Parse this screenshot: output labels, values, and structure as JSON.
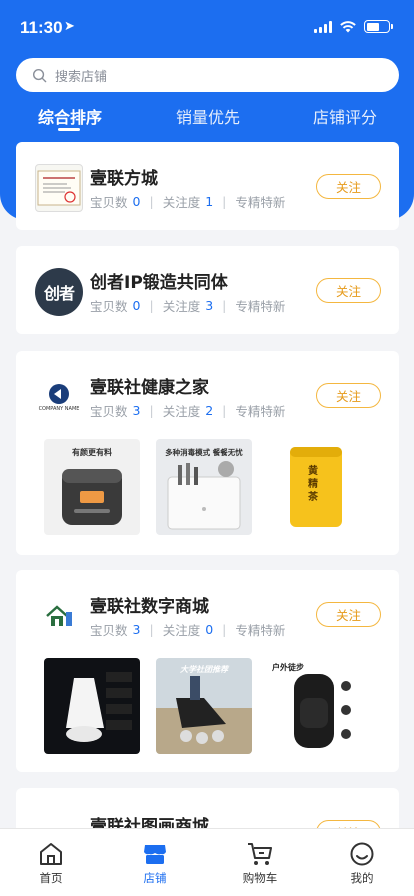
{
  "status_bar": {
    "time": "11:30",
    "location_arrow": "➤"
  },
  "search": {
    "placeholder": "搜索店铺",
    "icon": "search-icon"
  },
  "tabs": [
    {
      "label": "综合排序",
      "active": true
    },
    {
      "label": "销量优先",
      "active": false
    },
    {
      "label": "店铺评分",
      "active": false
    }
  ],
  "stores": [
    {
      "name": "壹联方城",
      "items_label": "宝贝数",
      "items": "0",
      "follow_label": "关注度",
      "follow_count": "1",
      "tag": "专精特新",
      "button": "关注"
    },
    {
      "name": "创者IP锻造共同体",
      "items_label": "宝贝数",
      "items": "0",
      "follow_label": "关注度",
      "follow_count": "3",
      "tag": "专精特新",
      "button": "关注",
      "logo_text": "创者"
    },
    {
      "name": "壹联社健康之家",
      "items_label": "宝贝数",
      "items": "3",
      "follow_label": "关注度",
      "follow_count": "2",
      "tag": "专精特新",
      "button": "关注",
      "logo_caption": "COMPANY NAME",
      "products": [
        {
          "caption": "有颜更有料"
        },
        {
          "caption": "多种消毒模式 餐餐无忧"
        },
        {
          "caption": "黄精茶"
        }
      ]
    },
    {
      "name": "壹联社数字商城",
      "items_label": "宝贝数",
      "items": "3",
      "follow_label": "关注度",
      "follow_count": "0",
      "tag": "专精特新",
      "button": "关注",
      "products": [
        {
          "caption": ""
        },
        {
          "caption": "大学社团推荐"
        },
        {
          "caption": "户外徒步"
        }
      ]
    },
    {
      "name": "壹联社图画商城",
      "button": "关注"
    }
  ],
  "tabbar": [
    {
      "label": "首页",
      "icon": "home-icon",
      "active": false
    },
    {
      "label": "店铺",
      "icon": "store-icon",
      "active": true
    },
    {
      "label": "购物车",
      "icon": "cart-icon",
      "active": false
    },
    {
      "label": "我的",
      "icon": "profile-icon",
      "active": false
    }
  ],
  "colors": {
    "primary": "#1c6ef0",
    "follow_border": "#f4b740",
    "follow_text": "#e69a1a"
  }
}
